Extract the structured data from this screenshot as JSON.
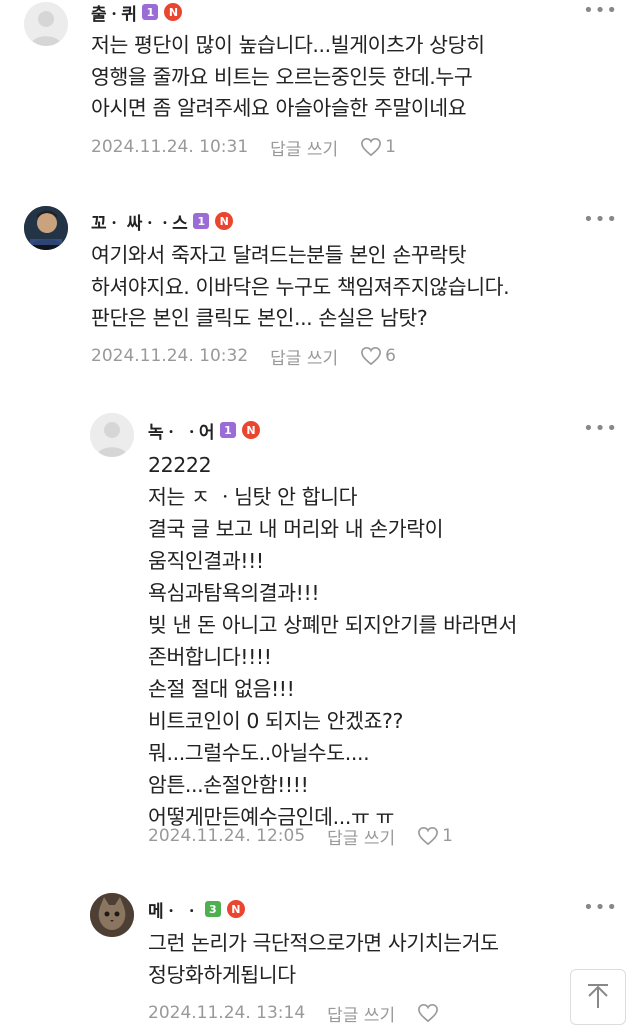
{
  "comments": [
    {
      "nickname": "출ㆍ퀴",
      "level": "1",
      "badge": "N",
      "more": "•••",
      "text": "저는 평단이 많이 높습니다...빌게이츠가 상당히\n영행을 줄까요 비트는 오르는중인듯 한데.누구\n아시면 좀 알려주세요 아슬아슬한 주말이네요",
      "date": "2024.11.24. 10:31",
      "reply": "답글 쓰기",
      "likes": "1",
      "level_color": "#9b6bd6"
    },
    {
      "nickname": "꼬ㆍ 싸ㆍㆍ스",
      "level": "1",
      "badge": "N",
      "more": "•••",
      "text": "여기와서 죽자고 달려드는분들 본인 손꾸락탓\n하셔야지요. 이바닥은 누구도 책임져주지않습니다.\n판단은 본인 클릭도 본인... 손실은 남탓?",
      "date": "2024.11.24. 10:32",
      "reply": "답글 쓰기",
      "likes": "6",
      "level_color": "#9b6bd6"
    },
    {
      "nickname": "녹ㆍ ㆍ어",
      "level": "1",
      "badge": "N",
      "more": "•••",
      "text": "22222\n저는 ㅈ ㆍ님탓 안 합니다\n결국 글 보고 내 머리와 내 손가락이\n움직인결과!!!\n욕심과탐욕의결과!!!\n빚 낸 돈 아니고 상폐만 되지안기를 바라면서\n존버합니다!!!!\n손절 절대 없음!!!\n비트코인이 0 되지는 안겠죠??\n뭐...그럴수도..아닐수도....\n암튼...손절안함!!!!\n어떻게만든예수금인데...ㅠ ㅠ",
      "date": "2024.11.24. 12:05",
      "reply": "답글 쓰기",
      "likes": "1",
      "level_color": "#9b6bd6"
    },
    {
      "nickname": "메ㆍ ㆍ",
      "level": "3",
      "badge": "N",
      "more": "•••",
      "text": "그런 논리가 극단적으로가면 사기치는거도\n정당화하게됩니다",
      "date": "2024.11.24. 13:14",
      "reply": "답글 쓰기",
      "likes": "",
      "level_color": "#4caf50"
    }
  ],
  "icons": {
    "heart": "heart-icon",
    "more": "more-icon",
    "top": "arrow-up-icon"
  }
}
